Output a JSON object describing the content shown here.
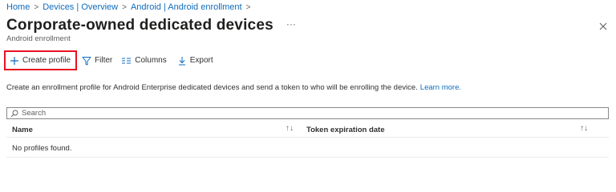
{
  "breadcrumb": [
    {
      "label": "Home"
    },
    {
      "label": "Devices | Overview"
    },
    {
      "label": "Android | Android enrollment"
    }
  ],
  "header": {
    "title": "Corporate-owned dedicated devices",
    "more_label": "···",
    "subtitle": "Android enrollment",
    "close_icon": "close-icon"
  },
  "toolbar": {
    "create_label": "Create profile",
    "filter_label": "Filter",
    "columns_label": "Columns",
    "export_label": "Export"
  },
  "description": {
    "text": "Create an enrollment profile for Android Enterprise dedicated devices and send a token to who will be enrolling the device.",
    "link": "Learn more."
  },
  "search": {
    "placeholder": "Search"
  },
  "table": {
    "columns": [
      "Name",
      "Token expiration date"
    ],
    "empty_text": "No profiles found."
  },
  "colors": {
    "accent": "#0f6cbd",
    "highlight_border": "#e81123"
  }
}
